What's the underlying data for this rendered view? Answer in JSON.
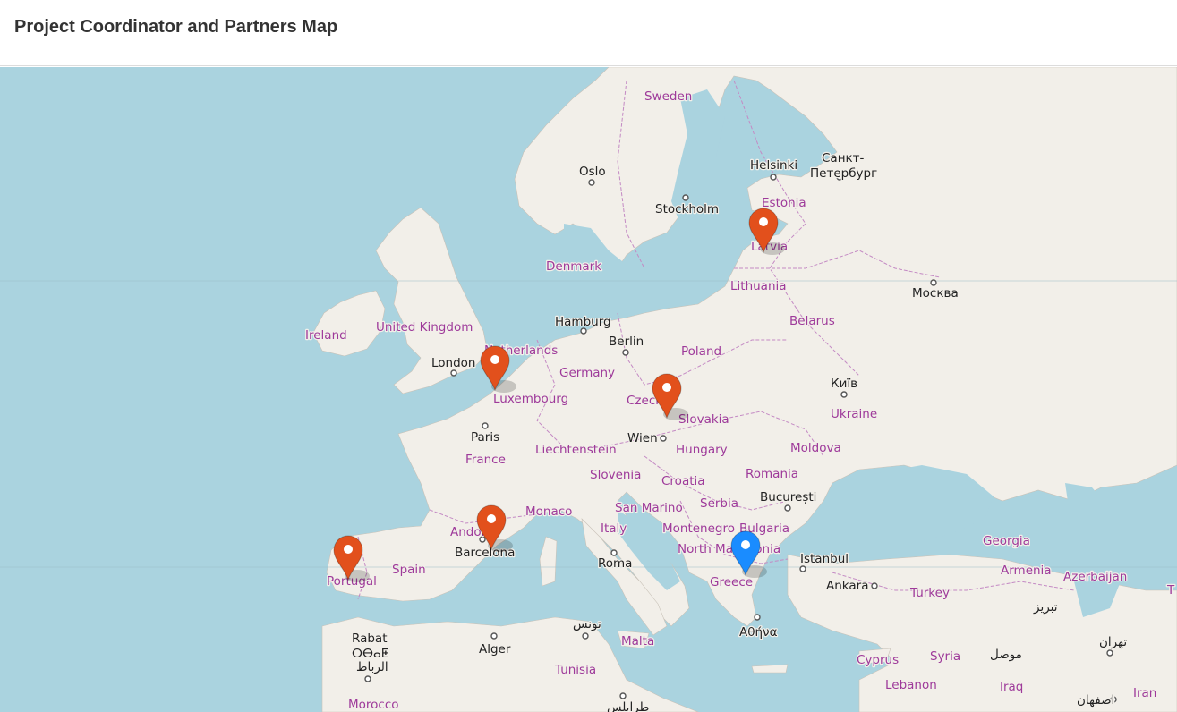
{
  "header": {
    "title": "Project Coordinator and Partners Map"
  },
  "map": {
    "tile_style": "OpenStreetMap standard",
    "colors": {
      "water": "#aad3df",
      "land": "#f2efe9",
      "border": "#c48ac4",
      "country_label": "#9e3a9a",
      "partner_marker": "#e2501c",
      "coordinator_marker": "#1a8cff"
    },
    "country_labels": [
      "Sweden",
      "Estonia",
      "Latvia",
      "Denmark",
      "Lithuania",
      "Belarus",
      "Ireland",
      "United Kingdom",
      "Netherlands",
      "Germany",
      "Poland",
      "Czechia",
      "Slovakia",
      "Ukraine",
      "Luxembourg",
      "France",
      "Liechtenstein",
      "Hungary",
      "Moldova",
      "Slovenia",
      "Croatia",
      "Romania",
      "Monaco",
      "San Marino",
      "Serbia",
      "Montenegro",
      "Bulgaria",
      "Andorra",
      "Italy",
      "North Macedonia",
      "Spain",
      "Portugal",
      "Greece",
      "Turkey",
      "Georgia",
      "Armenia",
      "Azerbaijan",
      "Malta",
      "Tunisia",
      "Cyprus",
      "Syria",
      "Lebanon",
      "Iraq",
      "Iran",
      "Morocco",
      "T"
    ],
    "city_labels": [
      "Oslo",
      "Stockholm",
      "Helsinki",
      "Санкт-",
      "Петербург",
      "Москва",
      "Hamburg",
      "Berlin",
      "London",
      "Київ",
      "Paris",
      "Wien",
      "București",
      "Barcelona",
      "Roma",
      "Istanbul",
      "Ankara",
      "Αθήνα",
      "Alger",
      "تونس",
      "Rabat",
      "ⵔⴱⴰⵟ",
      "الرباط",
      "موصل",
      "تبریز",
      "تهران",
      "اصفهان",
      "طرابلس"
    ],
    "markers": [
      {
        "role": "partner",
        "country": "Latvia"
      },
      {
        "role": "partner",
        "country": "Netherlands"
      },
      {
        "role": "partner",
        "country": "Czechia"
      },
      {
        "role": "partner",
        "country": "Andorra"
      },
      {
        "role": "partner",
        "country": "Portugal"
      },
      {
        "role": "coordinator",
        "country": "North Macedonia"
      }
    ]
  }
}
